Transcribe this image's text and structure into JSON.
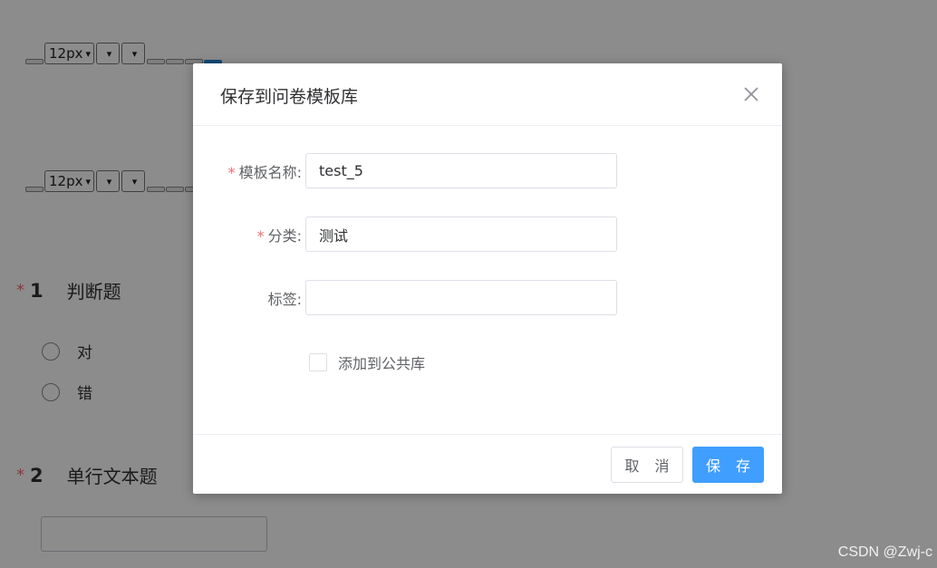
{
  "editor_toolbar": {
    "font_size": "12px",
    "chevron": "⌄"
  },
  "questions": [
    {
      "required_mark": "*",
      "number": "1",
      "title": "判断题",
      "options": [
        "对",
        "错"
      ]
    },
    {
      "required_mark": "*",
      "number": "2",
      "title": "单行文本题"
    }
  ],
  "dialog": {
    "title": "保存到问卷模板库",
    "close_icon": "close-icon",
    "fields": {
      "template_name": {
        "required_mark": "*",
        "label": "模板名称:",
        "value": "test_5"
      },
      "category": {
        "required_mark": "*",
        "label": "分类:",
        "value": "测试"
      },
      "tags": {
        "label": "标签:",
        "value": ""
      }
    },
    "public_checkbox": {
      "label": "添加到公共库",
      "checked": false
    },
    "buttons": {
      "cancel": "取 消",
      "save": "保 存"
    }
  },
  "watermark": "CSDN @Zwj-c",
  "colors": {
    "primary": "#409eff",
    "required": "#f56c6c",
    "overlay": "rgba(0,0,0,0.45)"
  }
}
